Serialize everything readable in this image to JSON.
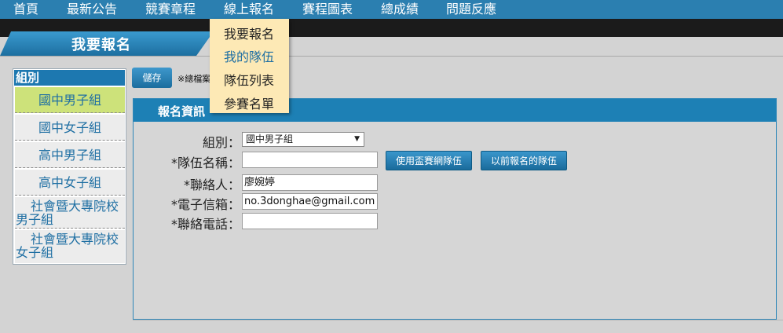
{
  "nav": {
    "items": [
      "首頁",
      "最新公告",
      "競賽章程",
      "線上報名",
      "賽程圖表",
      "總成績",
      "問題反應"
    ]
  },
  "page_title": "我要報名",
  "sidebar": {
    "heading": "組別",
    "groups": [
      {
        "label": "國中男子組",
        "selected": true
      },
      {
        "label": "國中女子組"
      },
      {
        "label": "高中男子組"
      },
      {
        "label": "高中女子組"
      },
      {
        "line1": "社會暨大專院校",
        "line2": "男子組"
      },
      {
        "line1": "社會暨大專院校",
        "line2": "女子組"
      }
    ]
  },
  "toolbar": {
    "save_label": "儲存",
    "note": "※總檔案"
  },
  "panel": {
    "title": "報名資訊"
  },
  "form": {
    "group_label": "組別：",
    "group_value": "國中男子組",
    "team_label": "*隊伍名稱：",
    "team_value": "",
    "contact_label": "*聯絡人：",
    "contact_value": "廖婉婷",
    "email_label": "*電子信箱：",
    "email_value": "no.3donghae@gmail.com",
    "phone_label": "*聯絡電話：",
    "phone_value": "",
    "use_team_button": "使用盃賽網隊伍",
    "previous_team_button": "以前報名的隊伍"
  },
  "dropdown": {
    "items": [
      "我要報名",
      "我的隊伍",
      "隊伍列表",
      "參賽名單"
    ],
    "highlighted_index": 1
  },
  "colors": {
    "nav_bg": "#2b7fb0",
    "accent_blue": "#1d80b5",
    "selected_group": "#cde27a",
    "dropdown_bg": "#fde9b5"
  }
}
